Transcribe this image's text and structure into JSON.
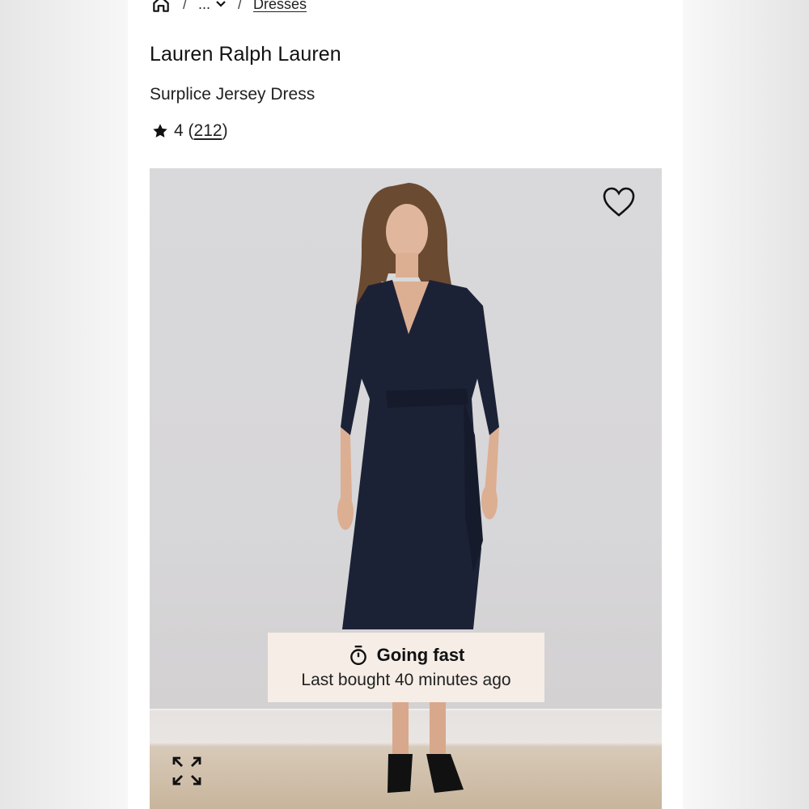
{
  "breadcrumb": {
    "home_icon": "home-icon",
    "separator": "/",
    "collapsed": "...",
    "collapsed_icon": "chevron-down-icon",
    "current": "Dresses"
  },
  "product": {
    "brand": "Lauren Ralph Lauren",
    "name": "Surplice Jersey Dress",
    "rating": "4",
    "review_count": "212",
    "rating_icon": "star-icon"
  },
  "image": {
    "description_icon": "favorite-heart-icon",
    "expand_icon": "expand-icon",
    "dress_color": "#1c2236"
  },
  "badge": {
    "title": "Going fast",
    "subtitle": "Last bought 40 minutes ago",
    "icon": "stopwatch-icon",
    "background": "#f5ede6"
  }
}
